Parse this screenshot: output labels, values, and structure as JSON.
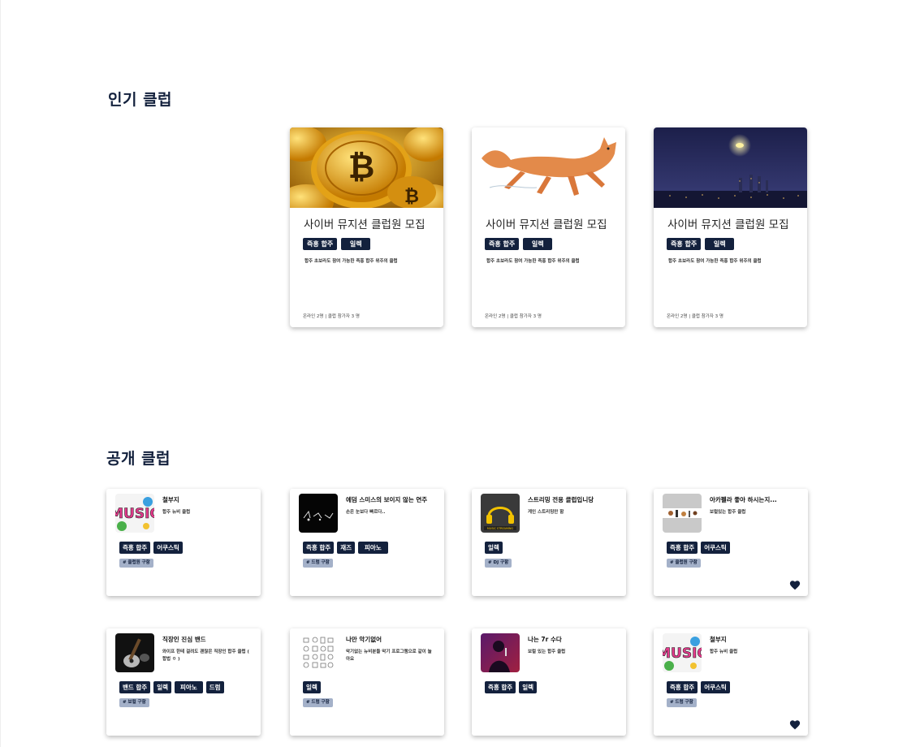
{
  "popular": {
    "title": "인기 클럽",
    "cards": [
      {
        "name": "사이버 뮤지션 클럽원 모집",
        "tags": [
          "즉흥 합주",
          "일렉"
        ],
        "desc": "합주 초보라도 참여 가능한 즉흥 합주 위주의 클럽",
        "meta": "온라인 2명 | 클럽 참가자 3 명",
        "image": "bitcoin-image"
      },
      {
        "name": "사이버 뮤지션 클럽원 모집",
        "tags": [
          "즉흥 합주",
          "일렉"
        ],
        "desc": "합주 초보라도 참여 가능한 즉흥 합주 위주의 클럽",
        "meta": "온라인 2명 | 클럽 참가자 3 명",
        "image": "fox-illustration-image"
      },
      {
        "name": "사이버 뮤지션 클럽원 모집",
        "tags": [
          "즉흥 합주",
          "일렉"
        ],
        "desc": "합주 초보라도 참여 가능한 즉흥 합주 위주의 클럽",
        "meta": "온라인 2명 | 클럽 참가자 3 명",
        "image": "night-city-image"
      }
    ]
  },
  "public": {
    "title": "공개 클럽",
    "cards": [
      {
        "name": "철부지",
        "desc": "합주 뉴비 클럽",
        "tags": [
          "즉흥 합주",
          "어쿠스틱"
        ],
        "recruit": "# 클럽원 구함",
        "liked": false,
        "image": "music-graffiti-image"
      },
      {
        "name": "에덤 스미스의 보이지 않는 연주",
        "desc": "손은 눈보다 빠르다..",
        "tags": [
          "즉흥 합주",
          "재즈",
          "피아노"
        ],
        "recruit": "# 드럼 구함",
        "liked": false,
        "image": "instrument-sketch-image"
      },
      {
        "name": "스트리밍 전용 클럽입니당",
        "desc": "게인 스트리밍만 함",
        "tags": [
          "일렉"
        ],
        "recruit": "# DJ 구함",
        "liked": false,
        "image": "headphones-image"
      },
      {
        "name": "아카펠라 좋아 하시는지...",
        "desc": "보컬있는 합주 클럽",
        "tags": [
          "즉흥 합주",
          "어쿠스틱"
        ],
        "recruit": "# 클럽원 구함",
        "liked": true,
        "image": "instrument-line-image"
      },
      {
        "name": "직장인 진심 밴드",
        "desc": "와이프 한테 걸려도 괜찮은 직장인 합주 클럽 ( 합법 ㅇ )",
        "tags": [
          "밴드 합주",
          "일렉",
          "피아노",
          "드럼"
        ],
        "recruit": "# 보컬 구함",
        "liked": false,
        "image": "guitar-image"
      },
      {
        "name": "나만 악기없어",
        "desc": "악기없는 뉴비분들 악기 프로그램으로 같이 놀아요",
        "tags": [
          "일렉"
        ],
        "recruit": "# 드럼 구함",
        "liked": false,
        "image": "instrument-icons-image"
      },
      {
        "name": "나는 7r 수다",
        "desc": "보컬 있는 합주 클럽",
        "tags": [
          "즉흥 합주",
          "일렉"
        ],
        "recruit": "",
        "liked": false,
        "image": "singer-image"
      },
      {
        "name": "철부지",
        "desc": "합주 뉴비 클럽",
        "tags": [
          "즉흥 합주",
          "어쿠스틱"
        ],
        "recruit": "# 드럼 구함",
        "liked": true,
        "image": "music-graffiti-image"
      }
    ]
  },
  "colors": {
    "navy": "#13213d",
    "badge": "#a4b1c9"
  }
}
